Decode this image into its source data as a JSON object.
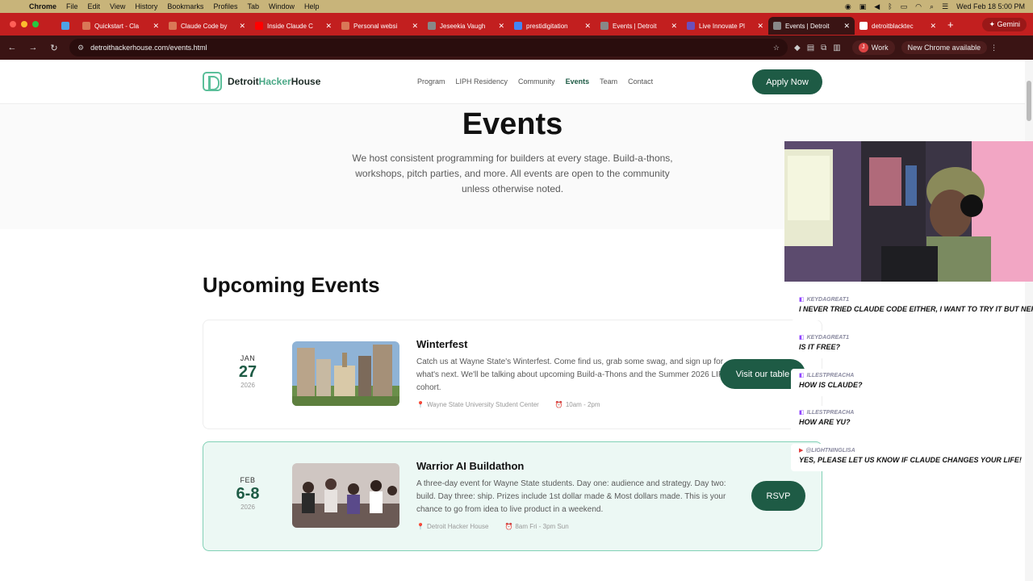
{
  "menubar": {
    "app": "Chrome",
    "items": [
      "File",
      "Edit",
      "View",
      "History",
      "Bookmarks",
      "Profiles",
      "Tab",
      "Window",
      "Help"
    ],
    "datetime": "Wed Feb 18  5:00 PM"
  },
  "tabs": [
    {
      "label": "Quickstart - Cla",
      "color": "#d97757"
    },
    {
      "label": "Claude Code by",
      "color": "#d97757"
    },
    {
      "label": "Inside Claude C",
      "color": "#ff0000"
    },
    {
      "label": "Personal websi",
      "color": "#d97757"
    },
    {
      "label": "Jeseekia Vaugh",
      "color": "#888888"
    },
    {
      "label": "prestidigitation",
      "color": "#4285f4"
    },
    {
      "label": "Events | Detroit",
      "color": "#888888"
    },
    {
      "label": "Live Innovate Pl",
      "color": "#6b4fbb"
    },
    {
      "label": "Events | Detroit",
      "color": "#888888"
    },
    {
      "label": "detroitblacktec",
      "color": "#ffffff"
    }
  ],
  "gemini_label": "Gemini",
  "toolbar": {
    "url": "detroithackerhouse.com/events.html",
    "profile_label": "Work",
    "profile_initial": "J",
    "update_label": "New Chrome available"
  },
  "site": {
    "brand_dark1": "Detroit",
    "brand_accent": "Hacker",
    "brand_dark2": "House",
    "nav": [
      "Program",
      "LIPH Residency",
      "Community",
      "Events",
      "Team",
      "Contact"
    ],
    "apply_label": "Apply Now",
    "accent_color": "#1e5b45"
  },
  "hero": {
    "title": "Events",
    "subtitle": "We host consistent programming for builders at every stage. Build-a-thons, workshops, pitch parties, and more. All events are open to the community unless otherwise noted."
  },
  "upcoming_heading": "Upcoming Events",
  "events": [
    {
      "month": "JAN",
      "day": "27",
      "year": "2026",
      "title": "Winterfest",
      "description": "Catch us at Wayne State's Winterfest. Come find us, grab some swag, and sign up for what's next. We'll be talking about upcoming Build-a-Thons and the Summer 2026 LIPH cohort.",
      "location": "Wayne State University Student Center",
      "time": "10am - 2pm",
      "cta": "Visit our table"
    },
    {
      "month": "FEB",
      "day": "6-8",
      "year": "2026",
      "title": "Warrior AI Buildathon",
      "description": "A three-day event for Wayne State students. Day one: audience and strategy. Day two: build. Day three: ship. Prizes include 1st dollar made & Most dollars made. This is your chance to go from idea to live product in a weekend.",
      "location": "Detroit Hacker House",
      "time": "8am Fri - 3pm Sun",
      "cta": "RSVP"
    }
  ],
  "chat": [
    {
      "user": "KEYDAGREAT1",
      "platform": "twitch",
      "message": "I NEVER TRIED CLAUDE CODE EITHER, I WANT TO TRY IT BUT NERVOUS LOL"
    },
    {
      "user": "KEYDAGREAT1",
      "platform": "twitch",
      "message": "IS IT FREE?"
    },
    {
      "user": "ILLESTPREACHA",
      "platform": "twitch",
      "message": "HOW IS CLAUDE?"
    },
    {
      "user": "ILLESTPREACHA",
      "platform": "twitch",
      "message": "HOW ARE YU?"
    },
    {
      "user": "@LIGHTNINGLISA",
      "platform": "youtube",
      "message": "YES, PLEASE LET US KNOW IF CLAUDE CHANGES YOUR LIFE!"
    }
  ]
}
